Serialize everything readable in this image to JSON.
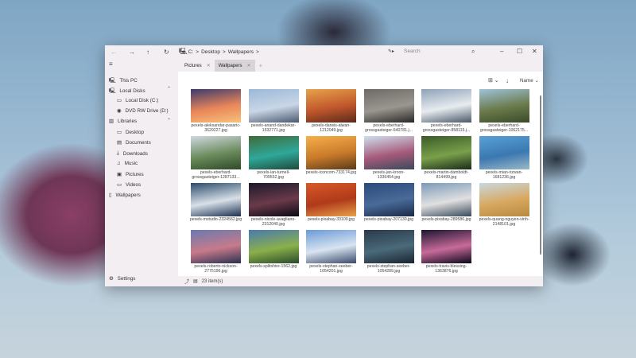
{
  "titlebar": {
    "breadcrumb": [
      "C:",
      "Desktop",
      "Wallpapers"
    ],
    "search_placeholder": "Search"
  },
  "tabs": [
    {
      "label": "Pictures"
    },
    {
      "label": "Wallpapers",
      "active": true
    }
  ],
  "sidebar": {
    "items": [
      {
        "label": "This PC",
        "icon": "computer-icon",
        "indent": 0
      },
      {
        "label": "Local Disks",
        "icon": "computer-icon",
        "indent": 0,
        "expanded": true
      },
      {
        "label": "Local Disk (C:)",
        "icon": "drive-icon",
        "indent": 1
      },
      {
        "label": "DVD RW Drive (D:)",
        "icon": "disc-icon",
        "indent": 1
      },
      {
        "label": "Libraries",
        "icon": "library-icon",
        "indent": 0,
        "expanded": true
      },
      {
        "label": "Desktop",
        "icon": "desktop-icon",
        "indent": 1
      },
      {
        "label": "Documents",
        "icon": "document-icon",
        "indent": 1
      },
      {
        "label": "Downloads",
        "icon": "download-icon",
        "indent": 1
      },
      {
        "label": "Music",
        "icon": "music-icon",
        "indent": 1
      },
      {
        "label": "Pictures",
        "icon": "picture-icon",
        "indent": 1
      },
      {
        "label": "Videos",
        "icon": "video-icon",
        "indent": 1
      },
      {
        "label": "Wallpapers",
        "icon": "folder-icon",
        "indent": 0
      }
    ],
    "settings": "Settings"
  },
  "toolbar": {
    "sort_label": "Name"
  },
  "files": [
    {
      "name": "pexels-aleksandar-pasaric-3629227.jpg",
      "colors": [
        "#3b3a6b",
        "#e9865a",
        "#f7c27a"
      ]
    },
    {
      "name": "pexels-anand-dandekar-1532771.jpg",
      "colors": [
        "#9bb8d8",
        "#c9d6e6",
        "#4a5a70"
      ]
    },
    {
      "name": "pexels-darwis-alwan-1212049.jpg",
      "colors": [
        "#e7a24a",
        "#c0572c",
        "#5a2a1a"
      ]
    },
    {
      "name": "pexels-eberhard-grossgasteiger-640781.j...",
      "colors": [
        "#6d6a66",
        "#9a9790",
        "#2a2826"
      ]
    },
    {
      "name": "pexels-eberhard-grossgasteiger-858115.j...",
      "colors": [
        "#8ea2b8",
        "#e8ecf0",
        "#4a5868"
      ]
    },
    {
      "name": "pexels-eberhard-grossgasteiger-1062175...",
      "colors": [
        "#9ec2d8",
        "#6a7a4a",
        "#3a4a2a"
      ]
    },
    {
      "name": "pexels-eberhard-grossgasteiger-1287133...",
      "colors": [
        "#cfd8e0",
        "#6a8a5a",
        "#2f4a2a"
      ]
    },
    {
      "name": "pexels-ian-turnell-709552.jpg",
      "colors": [
        "#3f6a3a",
        "#2fa89a",
        "#1f4a3a"
      ]
    },
    {
      "name": "pexels-iconcom-733174.jpg",
      "colors": [
        "#f6b04a",
        "#c97a2a",
        "#5a3a1a"
      ]
    },
    {
      "name": "pexels-jan-kroon-1336454.jpg",
      "colors": [
        "#cfe0ee",
        "#a65a7a",
        "#3a4a5a"
      ]
    },
    {
      "name": "pexels-martin-damboldt-814499.jpg",
      "colors": [
        "#3a5a2a",
        "#7aa04a",
        "#1a2a1a"
      ]
    },
    {
      "name": "pexels-mian-rizwan-1681236.jpg",
      "colors": [
        "#5aa0d8",
        "#3a78b0",
        "#9ab8c8"
      ]
    },
    {
      "name": "pexels-mstudio-2324562.jpg",
      "colors": [
        "#2a4a6a",
        "#d8e0e8",
        "#1a3050"
      ]
    },
    {
      "name": "pexels-nicole-avagliano-2312040.jpg",
      "colors": [
        "#1a1a2a",
        "#6a3a4a",
        "#0a0a14"
      ]
    },
    {
      "name": "pexels-pixabay-33109.jpg",
      "colors": [
        "#d8582a",
        "#b03a1a",
        "#e8a04a"
      ]
    },
    {
      "name": "pexels-pixabay-207130.jpg",
      "colors": [
        "#2a4a7a",
        "#4a6a98",
        "#1a2a48"
      ]
    },
    {
      "name": "pexels-pixabay-289586.jpg",
      "colors": [
        "#7a9ab8",
        "#e0e0e0",
        "#3a4a5a"
      ]
    },
    {
      "name": "pexels-quang-nguyen-vinh-2148101.jpg",
      "colors": [
        "#c8d8e0",
        "#d8a860",
        "#b88a40"
      ]
    },
    {
      "name": "pexels-roberto-nickson-2775196.jpg",
      "colors": [
        "#6a7ab0",
        "#c87a8a",
        "#2a3050"
      ]
    },
    {
      "name": "pexels-splitshire-1562.jpg",
      "colors": [
        "#4a7ab0",
        "#8ab04a",
        "#2a4a2a"
      ]
    },
    {
      "name": "pexels-stephan-seeber-1054201.jpg",
      "colors": [
        "#6a9ad8",
        "#d8e4f0",
        "#3a4a6a"
      ]
    },
    {
      "name": "pexels-stephan-seeber-1054289.jpg",
      "colors": [
        "#2a3a4a",
        "#4a6a7a",
        "#1a2430"
      ]
    },
    {
      "name": "pexels-travis-blessing-1363876.jpg",
      "colors": [
        "#1a1630",
        "#c86a9a",
        "#0a0818"
      ]
    }
  ],
  "status": {
    "count": "23 item(s)"
  }
}
